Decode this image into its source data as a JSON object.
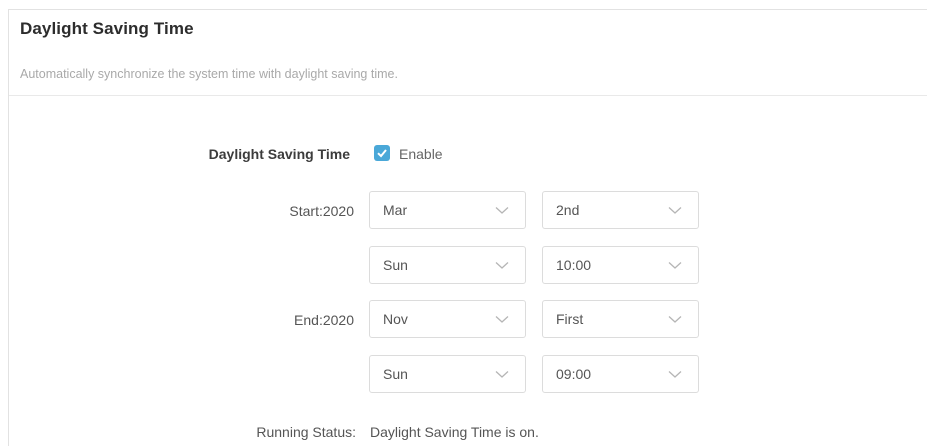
{
  "section": {
    "title": "Daylight Saving Time",
    "description": "Automatically synchronize the system time with daylight saving time."
  },
  "dst": {
    "label": "Daylight Saving Time",
    "enable_label": "Enable",
    "enabled": true
  },
  "start": {
    "label": "Start:2020",
    "month": "Mar",
    "week": "2nd",
    "day": "Sun",
    "time": "10:00"
  },
  "end": {
    "label": "End:2020",
    "month": "Nov",
    "week": "First",
    "day": "Sun",
    "time": "09:00"
  },
  "status": {
    "label": "Running Status:",
    "value": "Daylight Saving Time is on."
  },
  "colors": {
    "checkbox": "#4aa8d8",
    "text": "#555555",
    "muted": "#a9a9a9",
    "border": "#dcdcdc"
  },
  "icons": {
    "checkbox": "check-icon",
    "dropdown": "chevron-down-icon"
  }
}
